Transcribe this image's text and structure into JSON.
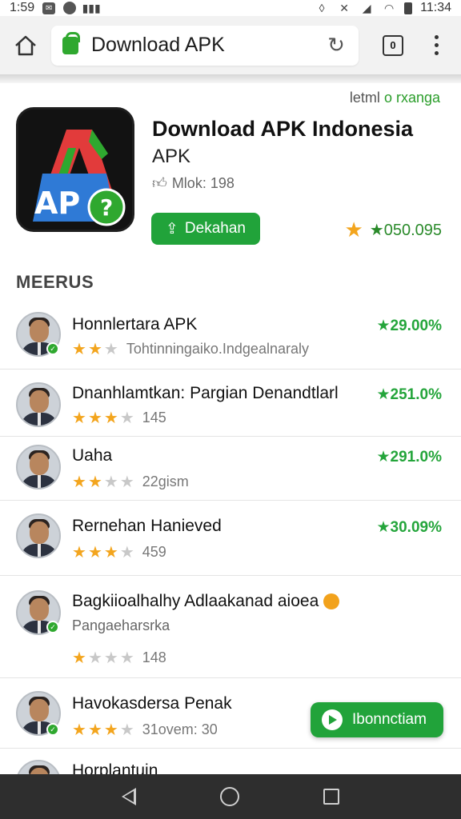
{
  "status_bar": {
    "time_left": "1:59",
    "time_right": "11:34"
  },
  "browser": {
    "url": "Download APK",
    "tab_count": "0"
  },
  "app": {
    "top_link_a": "letml",
    "top_link_b": "o rxanga",
    "title": "Download APK Indonesia",
    "subtitle": "APK",
    "meta": "Mlok: 198",
    "install_label": "Dekahan",
    "rating": "★050.095",
    "icon_text": "AP"
  },
  "section_title": "MEERUS",
  "rows": [
    {
      "title": "Honnlertara APK",
      "sub": "Tohtinningaiko.Indgealnaraly",
      "count": "",
      "pct": "★29.00%",
      "stars": 2
    },
    {
      "title": "Dnanhlamtkan: Pargian Denandtlarl",
      "sub": "",
      "count": "145",
      "pct": "★251.0%",
      "stars": 3
    },
    {
      "title": "Uaha",
      "sub": "",
      "count": "22gism",
      "pct": "★291.0%",
      "stars": 2
    },
    {
      "title": "Rernehan Hanieved",
      "sub": "",
      "count": "459",
      "pct": "★30.09%",
      "stars": 3
    },
    {
      "title": "Bagkiioalhalhy Adlaakanad aioea",
      "sub": "Pangaeharsrka",
      "count": "148",
      "pct": "",
      "stars": 1
    },
    {
      "title": "Havokasdersa Penak",
      "sub": "",
      "count": "31ovem: 30",
      "pct": "",
      "stars": 3
    },
    {
      "title": "Horplantuin",
      "sub": "",
      "count": "",
      "pct": "",
      "stars": 0
    }
  ],
  "fab": {
    "label": "Ibonnctiam"
  },
  "colors": {
    "accent": "#21a33a",
    "star": "#f3a51e",
    "nav": "#2e2e2e"
  }
}
